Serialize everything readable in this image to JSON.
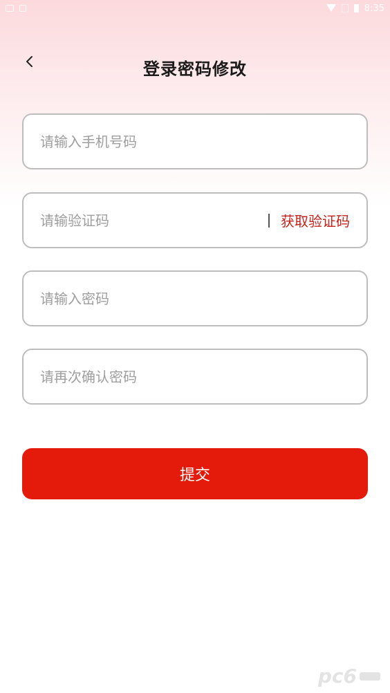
{
  "status_bar": {
    "time": "8:35"
  },
  "header": {
    "title": "登录密码修改"
  },
  "form": {
    "phone_placeholder": "请输入手机号码",
    "code_placeholder": "请输验证码",
    "get_code_label": "获取验证码",
    "password_placeholder": "请输入密码",
    "confirm_placeholder": "请再次确认密码",
    "submit_label": "提交"
  },
  "watermark": {
    "text": "pc6"
  },
  "colors": {
    "accent": "#e41b0b",
    "link": "#c8211a",
    "border": "#bdbdbd"
  }
}
